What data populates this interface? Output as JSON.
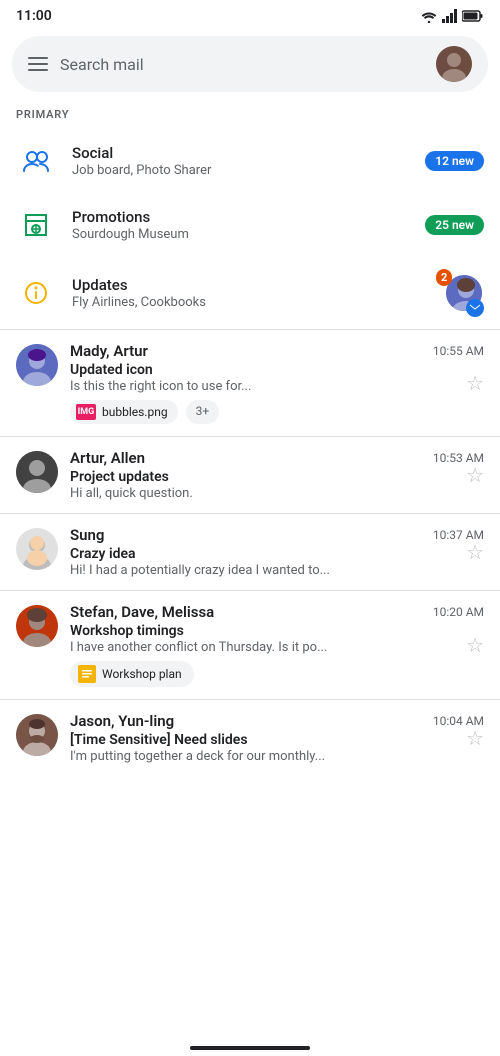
{
  "statusBar": {
    "time": "11:00"
  },
  "searchBar": {
    "placeholder": "Search mail"
  },
  "sectionLabel": "PRIMARY",
  "categories": [
    {
      "id": "social",
      "name": "Social",
      "sub": "Job board, Photo Sharer",
      "badgeText": "12 new",
      "badgeColor": "blue",
      "iconType": "social"
    },
    {
      "id": "promotions",
      "name": "Promotions",
      "sub": "Sourdough Museum",
      "badgeText": "25 new",
      "badgeColor": "green",
      "iconType": "tag"
    },
    {
      "id": "updates",
      "name": "Updates",
      "sub": "Fly Airlines, Cookbooks",
      "badgeCount": "2",
      "iconType": "updates"
    }
  ],
  "emails": [
    {
      "id": "email-1",
      "sender": "Mady, Artur",
      "time": "10:55 AM",
      "subject": "Updated icon",
      "preview": "Is this the right icon to use for...",
      "avatarColor": "#5c6bc0",
      "avatarBg": "indigo",
      "starred": false,
      "attachments": [
        {
          "name": "bubbles.png",
          "type": "img"
        }
      ],
      "attachmentMore": "3+"
    },
    {
      "id": "email-2",
      "sender": "Artur, Allen",
      "time": "10:53 AM",
      "subject": "Project updates",
      "preview": "Hi all, quick question.",
      "avatarColor": "#424242",
      "starred": false,
      "attachments": []
    },
    {
      "id": "email-3",
      "sender": "Sung",
      "time": "10:37 AM",
      "subject": "Crazy idea",
      "preview": "Hi! I had a potentially crazy idea I wanted to...",
      "avatarColor": "#e0e0e0",
      "avatarTextColor": "#424242",
      "starred": false,
      "attachments": []
    },
    {
      "id": "email-4",
      "sender": "Stefan, Dave, Melissa",
      "time": "10:20 AM",
      "subject": "Workshop timings",
      "preview": "I have another conflict on Thursday. Is it po...",
      "avatarColor": "#e65100",
      "starred": false,
      "attachments": [],
      "workshopChip": "Workshop plan"
    },
    {
      "id": "email-5",
      "sender": "Jason, Yun-ling",
      "time": "10:04 AM",
      "subject": "[Time Sensitive] Need slides",
      "preview": "I'm putting together a deck for our monthly...",
      "avatarColor": "#795548",
      "starred": false,
      "attachments": []
    }
  ],
  "bottomPill": true
}
